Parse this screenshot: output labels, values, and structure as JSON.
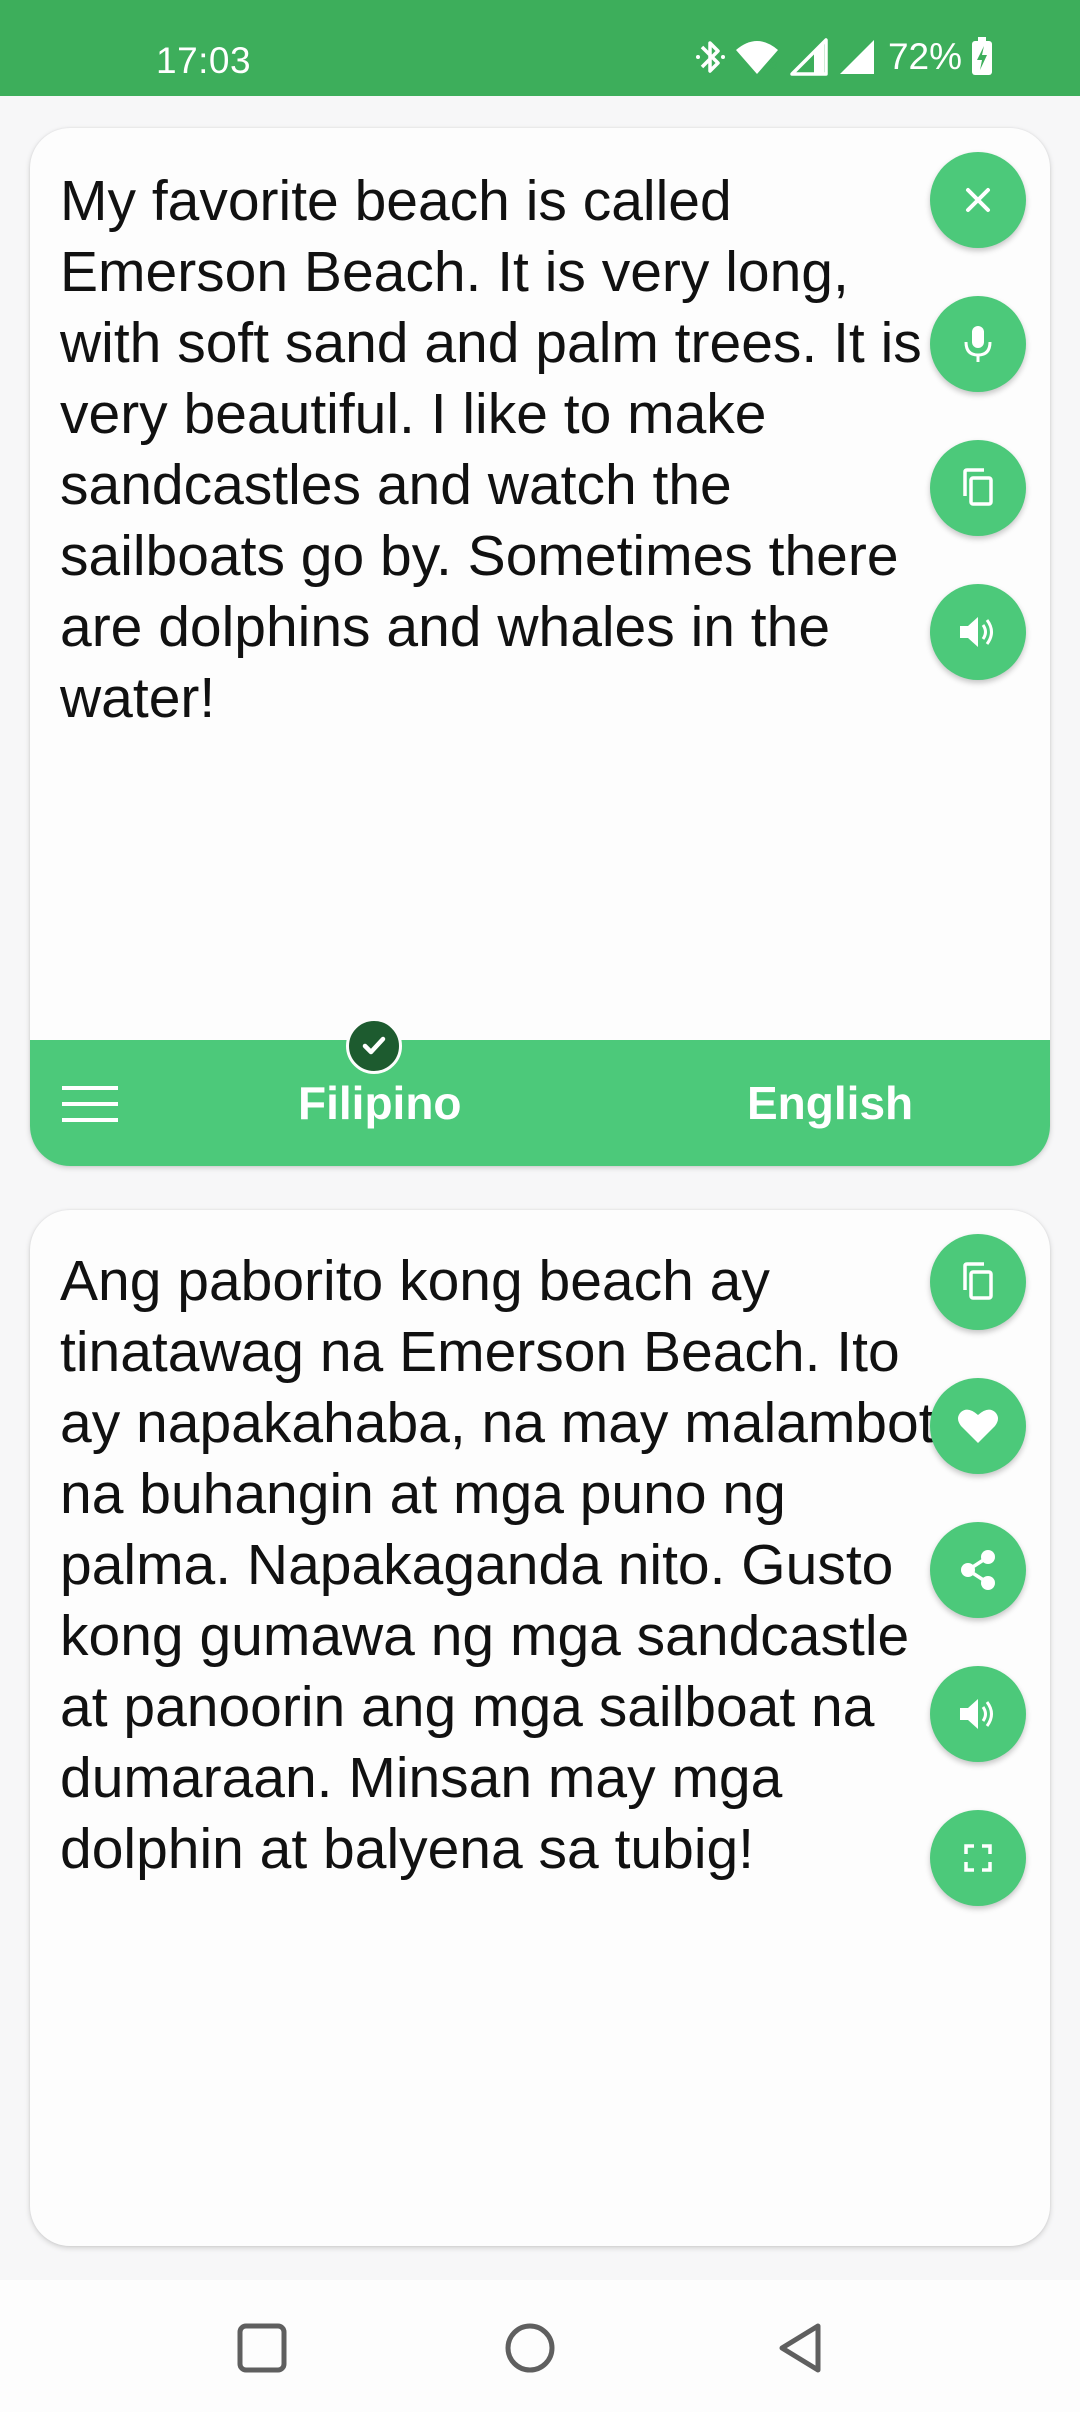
{
  "status_bar": {
    "time": "17:03",
    "battery": "72%",
    "icons": [
      "bluetooth-icon",
      "wifi-icon",
      "signal-icon",
      "signal-icon",
      "battery-charging-icon"
    ]
  },
  "input_card": {
    "text": "My favorite beach is called Emerson Beach. It is very long, with soft sand and palm trees. It is very beautiful. I like to make sandcastles and watch the sailboats go by. Sometimes there are dolphins and whales in the water!",
    "actions": [
      "close-icon",
      "microphone-icon",
      "copy-icon",
      "speaker-icon"
    ]
  },
  "language_bar": {
    "source_language": "Filipino",
    "target_language": "English",
    "selected": "Filipino"
  },
  "output_card": {
    "text": "Ang paborito kong beach ay tinatawag na Emerson Beach. Ito ay napakahaba, na may malambot na buhangin at mga puno ng palma. Napakaganda nito. Gusto kong gumawa ng mga sandcastle at panoorin ang mga sailboat na dumaraan. Minsan may mga dolphin at balyena sa tubig!",
    "actions": [
      "copy-icon",
      "heart-icon",
      "share-icon",
      "speaker-icon",
      "fullscreen-icon"
    ]
  },
  "colors": {
    "status_bar": "#3dae5b",
    "accent": "#4cc97a",
    "check_badge": "#1d5b2f"
  },
  "navigation": [
    "recent-apps-button",
    "home-button",
    "back-button"
  ]
}
